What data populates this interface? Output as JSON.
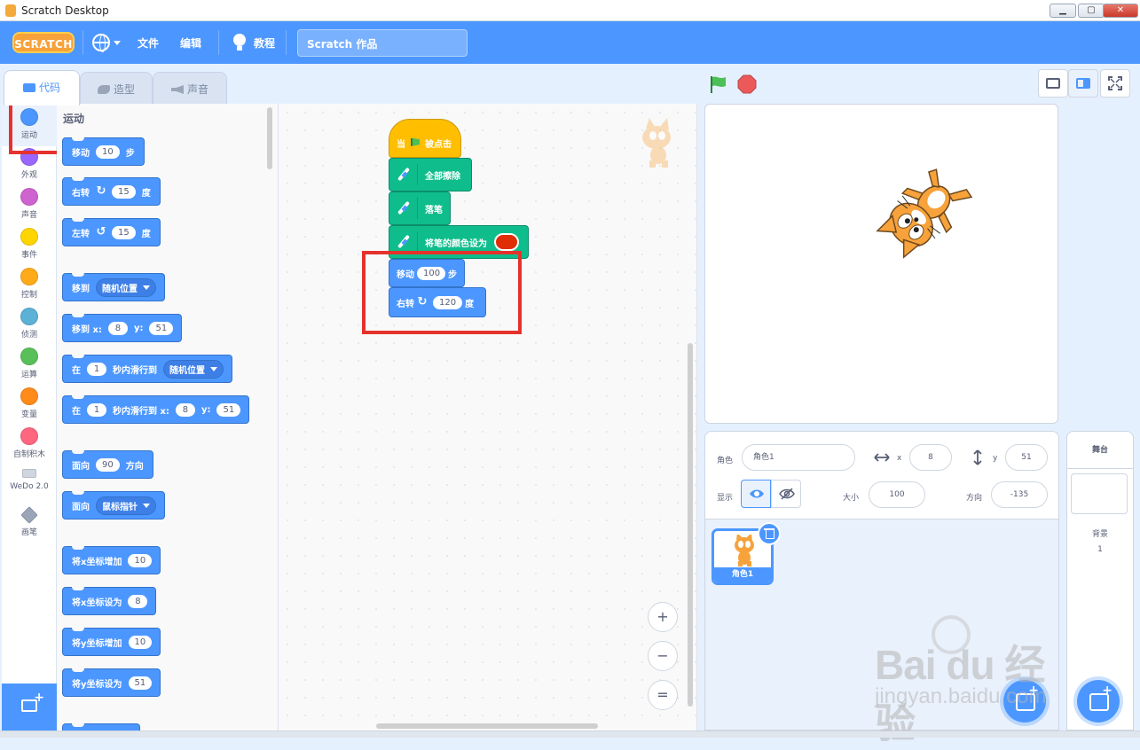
{
  "window": {
    "title": "Scratch Desktop",
    "minimize": "▁",
    "maximize": "▢",
    "close": "✕"
  },
  "menubar": {
    "logo": "SCRATCH",
    "file": "文件",
    "edit": "编辑",
    "tutorials": "教程",
    "project_title": "Scratch 作品"
  },
  "tabs": {
    "code": "代码",
    "costumes": "造型",
    "sounds": "声音"
  },
  "categories": [
    {
      "label": "运动",
      "color": "#4c97ff"
    },
    {
      "label": "外观",
      "color": "#9966ff"
    },
    {
      "label": "声音",
      "color": "#cf63cf"
    },
    {
      "label": "事件",
      "color": "#ffd500"
    },
    {
      "label": "控制",
      "color": "#ffab19"
    },
    {
      "label": "侦测",
      "color": "#5cb1d6"
    },
    {
      "label": "运算",
      "color": "#59c059"
    },
    {
      "label": "变量",
      "color": "#ff8c1a"
    },
    {
      "label": "自制积木",
      "color": "#ff6680"
    },
    {
      "label": "WeDo 2.0",
      "color": "#cccccc"
    },
    {
      "label": "画笔",
      "color": "#0fbd8c"
    }
  ],
  "palette": {
    "section": "运动",
    "move": {
      "a": "移动",
      "n": "10",
      "b": "步"
    },
    "turn_right": {
      "a": "右转",
      "n": "15",
      "b": "度"
    },
    "turn_left": {
      "a": "左转",
      "n": "15",
      "b": "度"
    },
    "goto": {
      "a": "移到",
      "dd": "随机位置"
    },
    "goto_xy": {
      "a": "移到 x:",
      "x": "8",
      "yl": "y:",
      "y": "51"
    },
    "glide": {
      "a": "在",
      "n": "1",
      "b": "秒内滑行到",
      "dd": "随机位置"
    },
    "glide_xy": {
      "a": "在",
      "n": "1",
      "b": "秒内滑行到 x:",
      "x": "8",
      "yl": "y:",
      "y": "51"
    },
    "point_dir": {
      "a": "面向",
      "n": "90",
      "b": "方向"
    },
    "point_towards": {
      "a": "面向",
      "dd": "鼠标指针"
    },
    "change_x": {
      "a": "将x坐标增加",
      "n": "10"
    },
    "set_x": {
      "a": "将x坐标设为",
      "n": "8"
    },
    "change_y": {
      "a": "将y坐标增加",
      "n": "10"
    },
    "set_y": {
      "a": "将y坐标设为",
      "n": "51"
    }
  },
  "script": {
    "hat": {
      "a": "当",
      "b": "被点击"
    },
    "clear": "全部擦除",
    "pen_down": "落笔",
    "set_color": "将笔的颜色设为",
    "move": {
      "a": "移动",
      "n": "100",
      "b": "步"
    },
    "turn": {
      "a": "右转",
      "n": "120",
      "b": "度"
    }
  },
  "zoom": {
    "in": "+",
    "out": "−",
    "reset": "="
  },
  "sprite_info": {
    "sprite_label": "角色",
    "sprite_name": "角色1",
    "x_label": "x",
    "x": "8",
    "y_label": "y",
    "y": "51",
    "show_label": "显示",
    "size_label": "大小",
    "size": "100",
    "direction_label": "方向",
    "direction": "-135"
  },
  "sprites": [
    {
      "name": "角色1"
    }
  ],
  "stage_target": {
    "title": "舞台",
    "backdrops_label": "背景",
    "backdrops_count": "1"
  },
  "watermark": {
    "brand": "Bai du 经验",
    "url": "jingyan.baidu.com"
  },
  "colors": {
    "accent": "#4c97ff",
    "highlight": "#e5322d",
    "pen": "#0fbd8c",
    "events": "#ffbf00"
  }
}
